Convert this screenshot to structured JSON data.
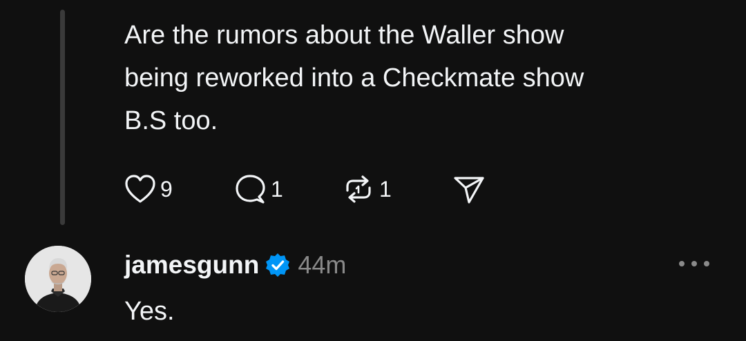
{
  "parent_post": {
    "text": "Are the rumors about the Waller show\nbeing reworked into a Checkmate show\nB.S too.",
    "likes": "9",
    "replies": "1",
    "reposts": "1",
    "icons": [
      "heart-icon",
      "reply-icon",
      "repost-icon",
      "share-icon"
    ]
  },
  "reply": {
    "username": "jamesgunn",
    "verified": true,
    "timestamp": "44m",
    "text": "Yes.",
    "more_icon": "more-icon"
  },
  "colors": {
    "background": "#101010",
    "text": "#f3f5f7",
    "muted": "#8a8a8a",
    "thread_line": "#3a3a3a",
    "verified": "#0095f6"
  }
}
